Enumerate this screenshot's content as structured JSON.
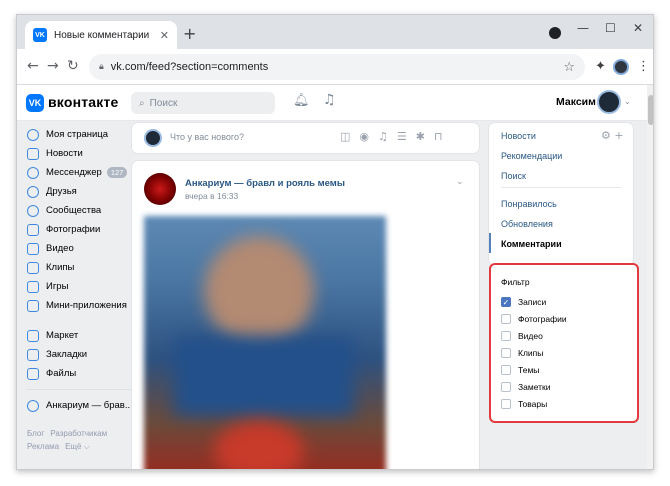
{
  "browser": {
    "tab_title": "Новые комментарии",
    "tab_favicon": "VK",
    "url": "vk.com/feed?section=comments"
  },
  "header": {
    "logo": "VK",
    "brand": "вконтакте",
    "search_placeholder": "Поиск",
    "user_name": "Максим"
  },
  "left_nav": {
    "items": [
      {
        "label": "Моя страница",
        "icon": "user-circle-icon"
      },
      {
        "label": "Новости",
        "icon": "news-icon"
      },
      {
        "label": "Мессенджер",
        "icon": "chat-icon",
        "badge": "127"
      },
      {
        "label": "Друзья",
        "icon": "friends-icon"
      },
      {
        "label": "Сообщества",
        "icon": "groups-icon"
      },
      {
        "label": "Фотографии",
        "icon": "photo-icon"
      },
      {
        "label": "Видео",
        "icon": "video-icon"
      },
      {
        "label": "Клипы",
        "icon": "clips-icon"
      },
      {
        "label": "Игры",
        "icon": "games-icon"
      },
      {
        "label": "Мини-приложения",
        "icon": "apps-icon"
      }
    ],
    "items2": [
      {
        "label": "Маркет",
        "icon": "market-icon"
      },
      {
        "label": "Закладки",
        "icon": "bookmark-icon"
      },
      {
        "label": "Файлы",
        "icon": "files-icon"
      }
    ],
    "group": {
      "label": "Анкариум — брав...",
      "icon": "group-icon"
    },
    "footer": {
      "blog": "Блог",
      "devs": "Разработчикам",
      "ads": "Реклама",
      "more": "Ещё ⌵"
    }
  },
  "composer": {
    "placeholder": "Что у вас нового?"
  },
  "post": {
    "author": "Анкариум — бравл и рояль мемы",
    "time": "вчера в 16:33"
  },
  "right_nav": {
    "items": [
      "Новости",
      "Рекомендации",
      "Поиск",
      "Понравилось",
      "Обновления",
      "Комментарии"
    ],
    "active": "Комментарии"
  },
  "filter": {
    "title": "Фильтр",
    "options": [
      {
        "label": "Записи",
        "checked": true
      },
      {
        "label": "Фотографии",
        "checked": false
      },
      {
        "label": "Видео",
        "checked": false
      },
      {
        "label": "Клипы",
        "checked": false
      },
      {
        "label": "Темы",
        "checked": false
      },
      {
        "label": "Заметки",
        "checked": false
      },
      {
        "label": "Товары",
        "checked": false
      }
    ],
    "highlight_color": "#e0393e"
  }
}
